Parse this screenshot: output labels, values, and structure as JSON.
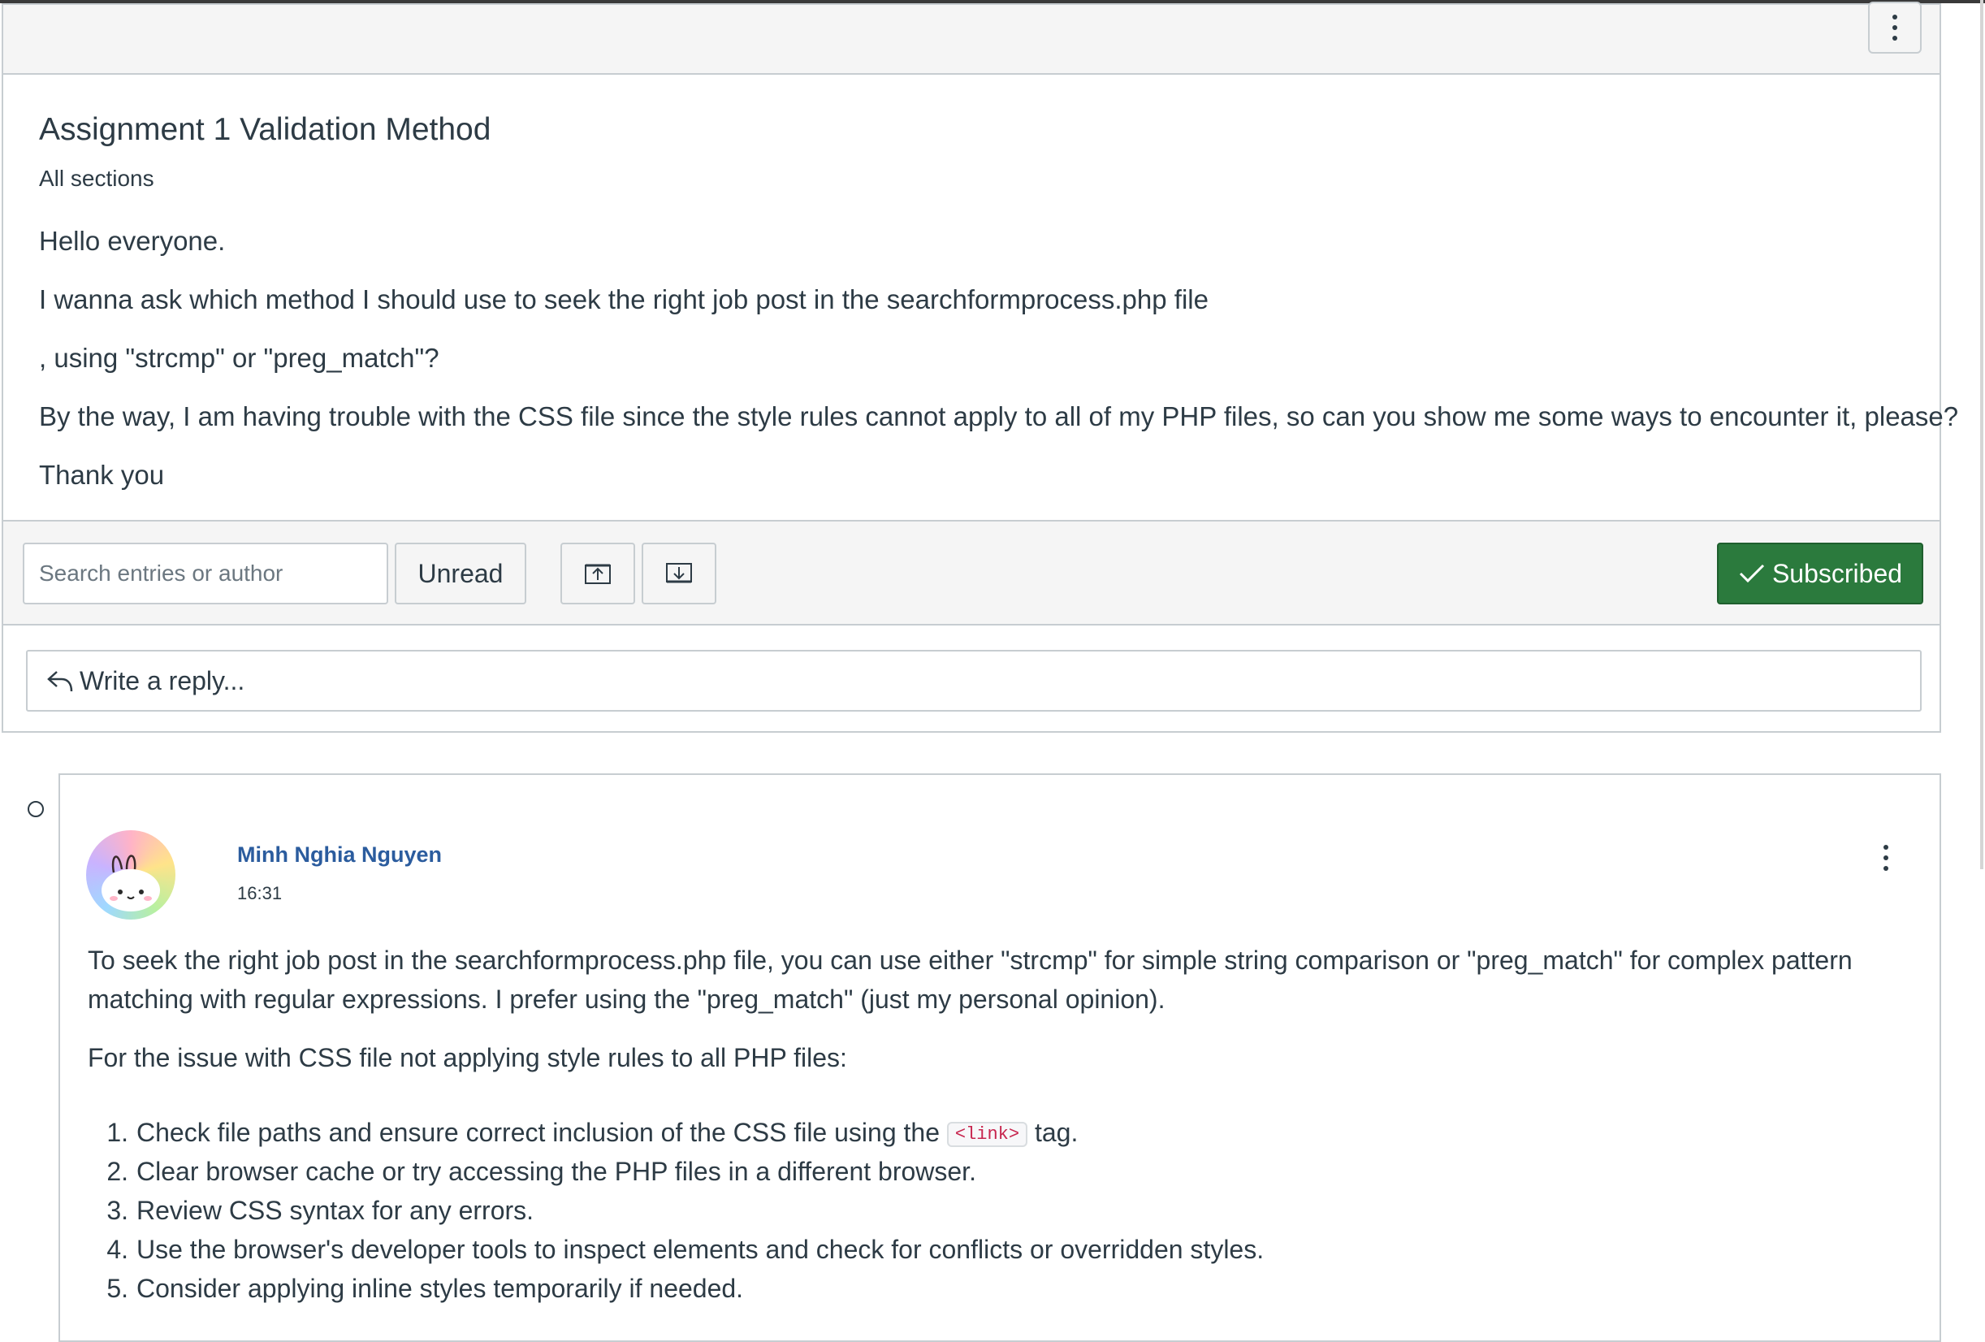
{
  "topic": {
    "title": "Assignment 1 Validation Method",
    "sections": "All sections",
    "body": [
      "Hello everyone.",
      "I wanna ask which method I should use to seek the right job post in the searchformprocess.php file",
      ", using \"strcmp\" or \"preg_match\"?",
      "By the way, I am having trouble with the CSS file since the style rules cannot apply to all of my PHP files, so can you show me some ways to encounter it, please?",
      "Thank you"
    ]
  },
  "toolbar": {
    "search_placeholder": "Search entries or author",
    "unread_label": "Unread",
    "collapse_icon": "collapse-up-arrow-icon",
    "expand_icon": "expand-down-arrow-icon",
    "subscribed_label": "Subscribed",
    "subscribed_color": "#2b7a3d"
  },
  "reply": {
    "label": "Write a reply..."
  },
  "entry": {
    "author": "Minh Nghia Nguyen",
    "time": "16:31",
    "author_color": "#2b5c9e",
    "paragraph1_line1": "To seek the right job post in the searchformprocess.php file, you can use either \"strcmp\" for simple string comparison or \"preg_match\" for complex pattern",
    "paragraph1_line2": "matching with regular expressions. I prefer using the \"preg_match\" (just my personal opinion).",
    "paragraph2": "For the issue with CSS file not applying style rules to all PHP files:",
    "list": [
      {
        "num": "1.",
        "before": "Check file paths and ensure correct inclusion of the CSS file using the",
        "code": "<link>",
        "after": "tag."
      },
      {
        "num": "2.",
        "text": "Clear browser cache or try accessing the PHP files in a different browser."
      },
      {
        "num": "3.",
        "text": "Review CSS syntax for any errors."
      },
      {
        "num": "4.",
        "text": "Use the browser's developer tools to inspect elements and check for conflicts or overridden styles."
      },
      {
        "num": "5.",
        "text": "Consider applying inline styles temporarily if needed."
      }
    ]
  }
}
